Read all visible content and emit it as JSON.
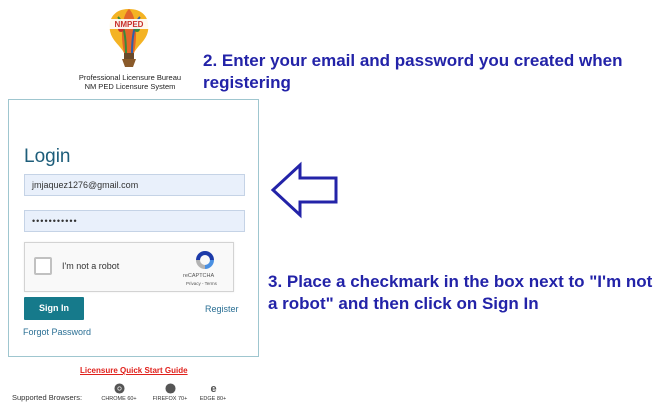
{
  "header": {
    "logo_text": "NMPED",
    "org_line1": "Professional Licensure Bureau",
    "org_line2": "NM PED Licensure System"
  },
  "instructions": {
    "step2": "2. Enter your email and password you created when registering",
    "step3": "3. Place a checkmark in the box next to \"I'm not a robot\" and then click on Sign In"
  },
  "login": {
    "title": "Login",
    "email_value": "jmjaquez1276@gmail.com",
    "password_value": "•••••••••••",
    "captcha_label": "I'm not a robot",
    "captcha_brand": "reCAPTCHA",
    "captcha_links": "Privacy - Terms",
    "signin_label": "Sign In",
    "register_label": "Register",
    "forgot_label": "Forgot Password"
  },
  "footer": {
    "guide_link": "Licensure Quick Start Guide",
    "browsers_label": "Supported Browsers:",
    "browsers": [
      {
        "name": "CHROME 60+",
        "icon": "chrome-icon"
      },
      {
        "name": "FIREFOX 70+",
        "icon": "firefox-icon"
      },
      {
        "name": "EDGE 80+",
        "icon": "edge-icon"
      }
    ]
  },
  "colors": {
    "instruction_text": "#2323a8",
    "signin_button": "#167a8b",
    "link": "#2a6f94",
    "guide_link": "#e0201b"
  }
}
